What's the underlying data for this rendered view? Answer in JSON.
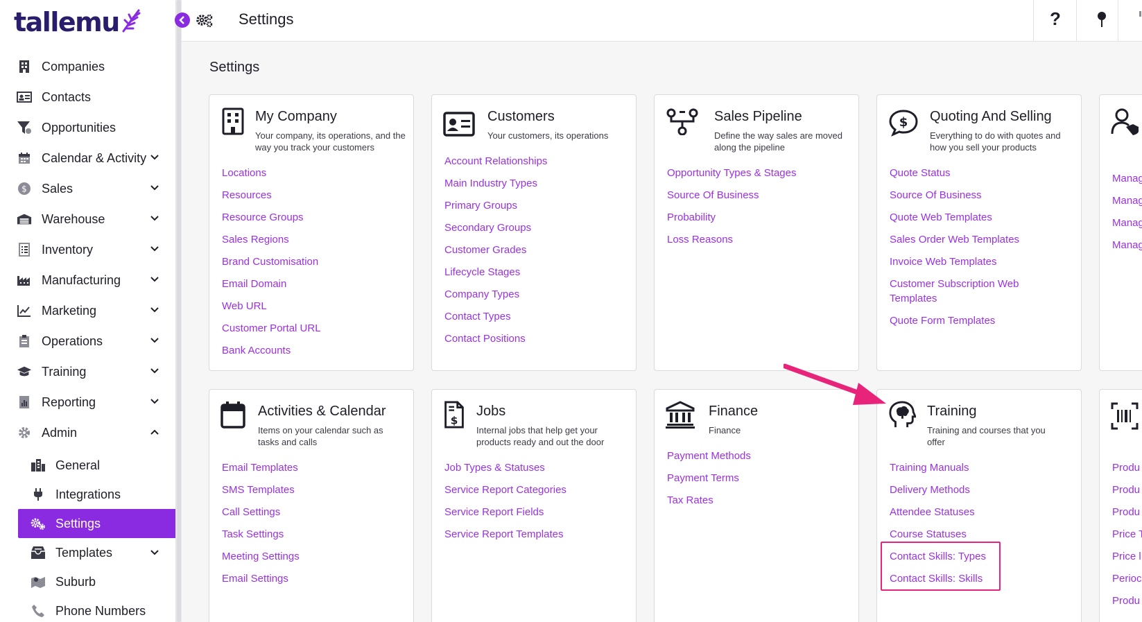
{
  "app": {
    "logo_text": "tallemu"
  },
  "sidebar": {
    "items": [
      {
        "label": "Companies",
        "icon": "building-icon",
        "expandable": false
      },
      {
        "label": "Contacts",
        "icon": "id-card-icon",
        "expandable": false
      },
      {
        "label": "Opportunities",
        "icon": "funnel-icon",
        "expandable": false
      },
      {
        "label": "Calendar & Activity",
        "icon": "calendar-icon",
        "expandable": true
      },
      {
        "label": "Sales",
        "icon": "dollar-coin-icon",
        "expandable": true
      },
      {
        "label": "Warehouse",
        "icon": "warehouse-icon",
        "expandable": true
      },
      {
        "label": "Inventory",
        "icon": "list-icon",
        "expandable": true
      },
      {
        "label": "Manufacturing",
        "icon": "factory-icon",
        "expandable": true
      },
      {
        "label": "Marketing",
        "icon": "trend-chart-icon",
        "expandable": true
      },
      {
        "label": "Operations",
        "icon": "clipboard-icon",
        "expandable": true
      },
      {
        "label": "Training",
        "icon": "graduation-cap-icon",
        "expandable": true
      },
      {
        "label": "Reporting",
        "icon": "report-icon",
        "expandable": true
      },
      {
        "label": "Admin",
        "icon": "cog-icon",
        "expandable": true,
        "expanded": true
      }
    ],
    "admin_sub": [
      {
        "label": "General",
        "icon": "city-icon"
      },
      {
        "label": "Integrations",
        "icon": "plug-icon"
      },
      {
        "label": "Settings",
        "icon": "gears-icon",
        "active": true
      },
      {
        "label": "Templates",
        "icon": "inbox-icon",
        "expandable": true
      },
      {
        "label": "Suburb",
        "icon": "map-icon"
      },
      {
        "label": "Phone Numbers",
        "icon": "phone-icon"
      }
    ]
  },
  "topbar": {
    "title": "Settings",
    "help": "?"
  },
  "page": {
    "heading": "Settings"
  },
  "cards": {
    "my_company": {
      "title": "My Company",
      "desc": "Your company, its operations, and the way you track your customers",
      "links": [
        "Locations",
        "Resources",
        "Resource Groups",
        "Sales Regions",
        "Brand Customisation",
        "Email Domain",
        "Web URL",
        "Customer Portal URL",
        "Bank Accounts"
      ]
    },
    "customers": {
      "title": "Customers",
      "desc": "Your customers, its operations",
      "links": [
        "Account Relationships",
        "Main Industry Types",
        "Primary Groups",
        "Secondary Groups",
        "Customer Grades",
        "Lifecycle Stages",
        "Company Types",
        "Contact Types",
        "Contact Positions"
      ]
    },
    "sales_pipeline": {
      "title": "Sales Pipeline",
      "desc": "Define the way sales are moved along the pipeline",
      "links": [
        "Opportunity Types & Stages",
        "Source Of Business",
        "Probability",
        "Loss Reasons"
      ]
    },
    "quoting": {
      "title": "Quoting And Selling",
      "desc": "Everything to do with quotes and how you sell your products",
      "links": [
        "Quote Status",
        "Source Of Business",
        "Quote Web Templates",
        "Sales Order Web Templates",
        "Invoice Web Templates",
        "Customer Subscription Web Templates",
        "Quote Form Templates"
      ]
    },
    "partial_top": {
      "links": [
        "Manag",
        "Manag",
        "Manag",
        "Manag"
      ]
    },
    "activities": {
      "title": "Activities & Calendar",
      "desc": "Items on your calendar such as tasks and calls",
      "links": [
        "Email Templates",
        "SMS Templates",
        "Call Settings",
        "Task Settings",
        "Meeting Settings",
        "Email Settings"
      ]
    },
    "jobs": {
      "title": "Jobs",
      "desc": "Internal jobs that help get your products ready and out the door",
      "links": [
        "Job Types & Statuses",
        "Service Report Categories",
        "Service Report Fields",
        "Service Report Templates"
      ]
    },
    "finance": {
      "title": "Finance",
      "desc": "Finance",
      "links": [
        "Payment Methods",
        "Payment Terms",
        "Tax Rates"
      ]
    },
    "training": {
      "title": "Training",
      "desc": "Training and courses that you offer",
      "links": [
        "Training Manuals",
        "Delivery Methods",
        "Attendee Statuses",
        "Course Statuses",
        "Contact Skills: Types",
        "Contact Skills: Skills"
      ]
    },
    "partial_bottom": {
      "links": [
        "Produ",
        "Produ",
        "Produ",
        "Price T",
        "Price l",
        "Perioc",
        "Produ"
      ]
    }
  },
  "colors": {
    "accent": "#8a2be2",
    "link": "#9b30e8",
    "annotation": "#e8247a"
  }
}
